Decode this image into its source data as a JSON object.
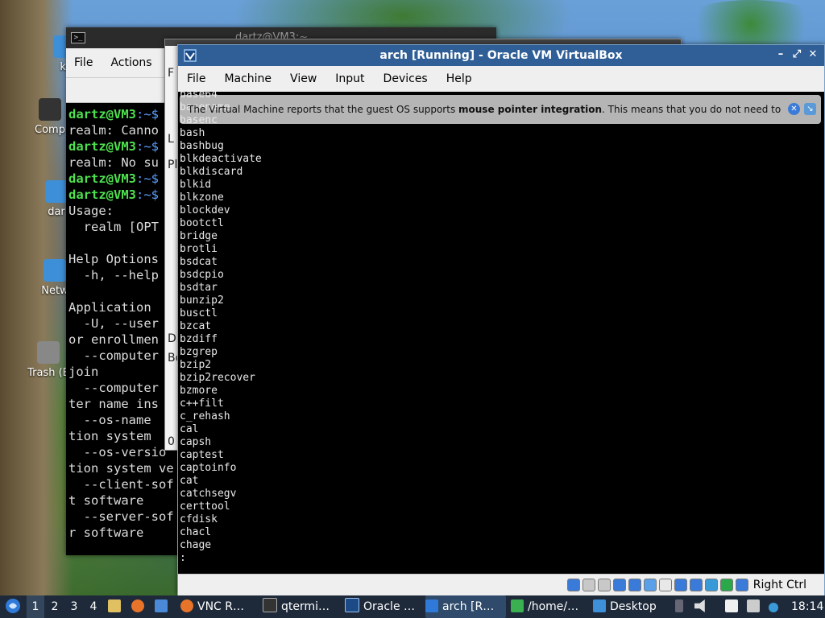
{
  "desktop": {
    "icons": [
      {
        "label": "ki",
        "icon": "folder-icon"
      },
      {
        "label": "Comp",
        "icon": "computer-icon"
      },
      {
        "label": "dar",
        "icon": "home-folder-icon"
      },
      {
        "label": "Netw",
        "icon": "network-icon"
      },
      {
        "label": "Trash (E",
        "icon": "trash-icon"
      }
    ]
  },
  "qterminal": {
    "title": "dartz@VM3:~",
    "menu": [
      "File",
      "Actions"
    ],
    "prompt": "dartz@VM3",
    "prompt_suffix": ":~$",
    "lines": [
      {
        "type": "prompt",
        "text": ""
      },
      {
        "type": "out",
        "text": "realm: Canno"
      },
      {
        "type": "prompt",
        "text": ""
      },
      {
        "type": "out",
        "text": "realm: No su"
      },
      {
        "type": "prompt",
        "text": ""
      },
      {
        "type": "prompt",
        "text": ""
      },
      {
        "type": "out",
        "text": "Usage:"
      },
      {
        "type": "out",
        "text": "  realm [OPT"
      },
      {
        "type": "out",
        "text": ""
      },
      {
        "type": "out",
        "text": "Help Options"
      },
      {
        "type": "out",
        "text": "  -h, --help"
      },
      {
        "type": "out",
        "text": ""
      },
      {
        "type": "out",
        "text": "Application"
      },
      {
        "type": "out",
        "text": "  -U, --user"
      },
      {
        "type": "out",
        "text": "or enrollmen"
      },
      {
        "type": "out",
        "text": "  --computer"
      },
      {
        "type": "out",
        "text": "join"
      },
      {
        "type": "out",
        "text": "  --computer"
      },
      {
        "type": "out",
        "text": "ter name ins"
      },
      {
        "type": "out",
        "text": "  --os-name"
      },
      {
        "type": "out",
        "text": "tion system"
      },
      {
        "type": "out",
        "text": "  --os-versio"
      },
      {
        "type": "out",
        "text": "tion system ve"
      },
      {
        "type": "out",
        "text": "  --client-sof"
      },
      {
        "type": "out",
        "text": "t software"
      },
      {
        "type": "out",
        "text": "  --server-sof"
      },
      {
        "type": "out",
        "text": "r software"
      }
    ]
  },
  "filemanager": {
    "menu_label": "F",
    "side_letters": [
      "L",
      "Pl",
      "D",
      "Bo",
      "0"
    ]
  },
  "vbox": {
    "title": "arch [Running] - Oracle VM VirtualBox",
    "menu": [
      "File",
      "Machine",
      "View",
      "Input",
      "Devices",
      "Help"
    ],
    "notice_pre": "The Virtual Machine reports that the guest OS supports ",
    "notice_bold": "mouse pointer integration",
    "notice_post": ". This means that you do not need to",
    "guest_lines": [
      "base64",
      "basename",
      "basenc",
      "bash",
      "bashbug",
      "blkdeactivate",
      "blkdiscard",
      "blkid",
      "blkzone",
      "blockdev",
      "bootctl",
      "bridge",
      "brotli",
      "bsdcat",
      "bsdcpio",
      "bsdtar",
      "bunzip2",
      "busctl",
      "bzcat",
      "bzdiff",
      "bzgrep",
      "bzip2",
      "bzip2recover",
      "bzmore",
      "c++filt",
      "c_rehash",
      "cal",
      "capsh",
      "captest",
      "captoinfo",
      "cat",
      "catchsegv",
      "certtool",
      "cfdisk",
      "chacl",
      "chage",
      ":"
    ],
    "host_key": "Right Ctrl",
    "status_icons": [
      "hard-disk-icon",
      "optical-drive-icon",
      "audio-icon",
      "network-icon",
      "usb-icon",
      "shared-folders-icon",
      "display-icon",
      "recording-icon",
      "capture-icon",
      "cpu-icon",
      "mouse-integration-icon",
      "arrow-icon"
    ]
  },
  "taskbar": {
    "workspaces": [
      "1",
      "2",
      "3",
      "4"
    ],
    "items": [
      {
        "label": "VNC R…",
        "icon": "firefox-icon"
      },
      {
        "label": "qtermi…",
        "icon": "terminal-icon"
      },
      {
        "label": "Oracle …",
        "icon": "virtualbox-icon"
      },
      {
        "label": "arch [R…",
        "icon": "virtualbox-arch-icon"
      },
      {
        "label": "/home/…",
        "icon": "file-manager-icon"
      },
      {
        "label": "Desktop",
        "icon": "folder-icon"
      }
    ],
    "clock": "18:14"
  }
}
